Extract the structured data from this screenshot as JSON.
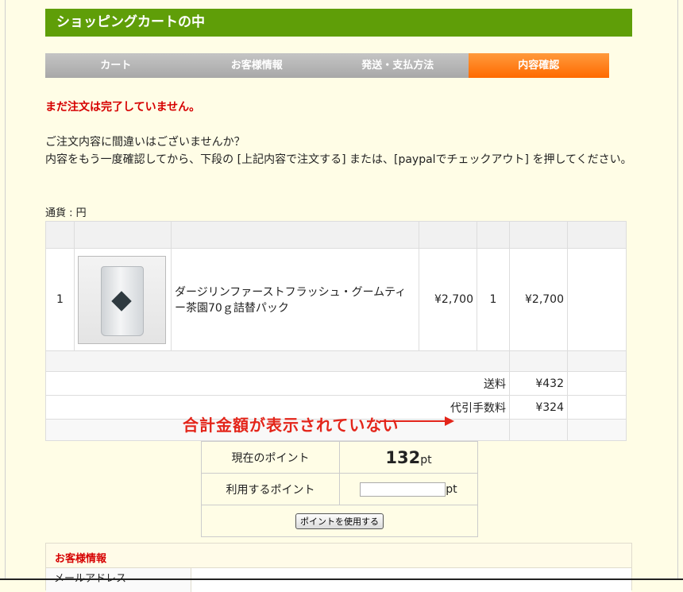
{
  "header": {
    "title": "ショッピングカートの中"
  },
  "steps": [
    {
      "label": "カート",
      "active": false
    },
    {
      "label": "お客様情報",
      "active": false
    },
    {
      "label": "発送・支払方法",
      "active": false
    },
    {
      "label": "内容確認",
      "active": true
    }
  ],
  "warning": "まだ注文は完了していません。",
  "message": {
    "line1": "ご注文内容に間違いはございませんか？",
    "line2": "内容をもう一度確認してから、下段の [上記内容で注文する] または、[paypalでチェックアウト] を押してください。"
  },
  "currency_label": "通貨 : 円",
  "cart": {
    "items": [
      {
        "no": "1",
        "name": "ダージリンファーストフラッシュ・グームティー茶園70ｇ詰替パック",
        "price": "¥2,700",
        "qty": "1",
        "subtotal": "¥2,700"
      }
    ],
    "fees": [
      {
        "label": "送料",
        "value": "¥432"
      },
      {
        "label": "代引手数料",
        "value": "¥324"
      }
    ]
  },
  "annotation": "合計金額が表示されていない",
  "points": {
    "current_label": "現在のポイント",
    "current_value": "132",
    "unit": "pt",
    "use_label": "利用するポイント",
    "use_input_value": "",
    "use_button": "ポイントを使用する"
  },
  "customer": {
    "title": "お客様情報",
    "row_label": "メールアドレス"
  },
  "colors": {
    "header_bg": "#5f9e08",
    "active_step": "#ff6a00",
    "warning": "#d60000",
    "annotation": "#e3251a"
  }
}
